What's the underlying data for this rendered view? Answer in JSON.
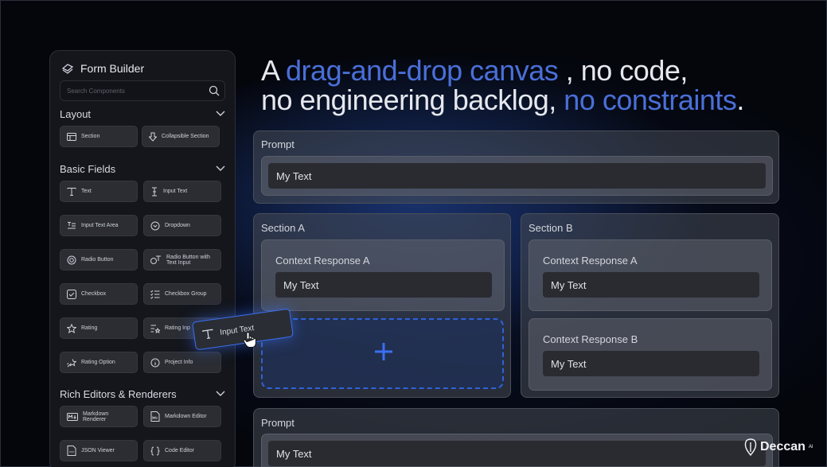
{
  "sidebar": {
    "title": "Form Builder",
    "search_placeholder": "Search Components",
    "sections": [
      {
        "label": "Layout"
      },
      {
        "label": "Basic Fields"
      },
      {
        "label": "Rich Editors & Renderers"
      }
    ],
    "layout_items": [
      "Section",
      "Collapsible Section"
    ],
    "basic_items": [
      "Text",
      "Input Text",
      "Input Text Area",
      "Dropdown",
      "Radio Button",
      "Radio Button with Text Input",
      "Checkbox",
      "Checkbox Group",
      "Rating",
      "Rating Inp",
      "Rating Option",
      "Project Info"
    ],
    "rich_items": [
      "Markdown Renderer",
      "Markdown Editor",
      "JSON Viewer",
      "Code Editor"
    ]
  },
  "headline": {
    "part1": "A ",
    "accent1": "drag-and-drop canvas",
    "part2": " , no code,",
    "part3": "no engineering backlog, ",
    "accent2": "no constraints",
    "part4": "."
  },
  "canvas": {
    "prompt_top": {
      "label": "Prompt",
      "value": "My Text"
    },
    "section_a": {
      "label": "Section  A",
      "card_label": "Context Response A",
      "card_value": "My Text"
    },
    "section_b": {
      "label": "Section  B",
      "cards": [
        {
          "label": "Context Response A",
          "value": "My Text"
        },
        {
          "label": "Context Response B",
          "value": "My Text"
        }
      ]
    },
    "prompt_bottom": {
      "label": "Prompt",
      "value": "My Text"
    }
  },
  "drag_item": {
    "label": "Input Text"
  },
  "brand": {
    "name": "Deccan",
    "suffix": "AI"
  },
  "colors": {
    "accent": "#4a6fd8",
    "drop_border": "#2f63d6",
    "background": "#04060c"
  }
}
